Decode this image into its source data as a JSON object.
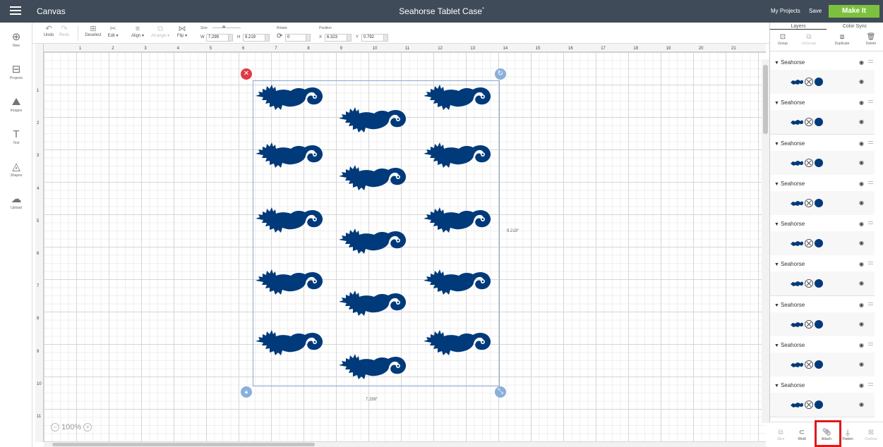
{
  "topbar": {
    "app_name": "Canvas",
    "doc_title": "Seahorse Tablet Case",
    "doc_modified": "*",
    "my_projects": "My Projects",
    "save": "Save",
    "make_it": "Make It"
  },
  "toolbar": {
    "undo": "Undo",
    "redo": "Redo",
    "deselect": "Deselect",
    "edit": "Edit ▾",
    "align": "Align ▾",
    "arrange": "Arrange ▾",
    "flip": "Flip ▾",
    "size_label": "Size",
    "w_label": "W",
    "w_value": "7.299",
    "h_label": "H",
    "h_value": "9.219",
    "rotate_label": "Rotate",
    "rotate_value": "0",
    "position_label": "Position",
    "x_label": "X",
    "x_value": "6.323",
    "y_label": "Y",
    "y_value": "0.792"
  },
  "leftpanel": {
    "new": "New",
    "projects": "Projects",
    "images": "Images",
    "text": "Text",
    "shapes": "Shapes",
    "upload": "Upload"
  },
  "ruler": {
    "top": [
      "1",
      "2",
      "3",
      "4",
      "5",
      "6",
      "7",
      "8",
      "9",
      "10",
      "11",
      "12",
      "13",
      "14",
      "15",
      "16",
      "17",
      "18",
      "19",
      "20",
      "21"
    ],
    "left": [
      "1",
      "2",
      "3",
      "4",
      "5",
      "6",
      "7",
      "8",
      "9",
      "10",
      "11"
    ]
  },
  "canvas": {
    "width_label": "7.299\"",
    "height_label": "9.219\"",
    "zoom": "100%",
    "design_color": "#003a7a"
  },
  "rightpanel": {
    "tab_layers": "Layers",
    "tab_color_sync": "Color Sync",
    "group": "Group",
    "ungroup": "UnGroup",
    "duplicate": "Duplicate",
    "delete": "Delete",
    "layers": [
      {
        "name": "Seahorse"
      },
      {
        "name": "Seahorse"
      },
      {
        "name": "Seahorse"
      },
      {
        "name": "Seahorse"
      },
      {
        "name": "Seahorse"
      },
      {
        "name": "Seahorse"
      },
      {
        "name": "Seahorse"
      },
      {
        "name": "Seahorse"
      },
      {
        "name": "Seahorse"
      }
    ],
    "bottom": {
      "slice": "Slice",
      "weld": "Weld",
      "attach": "Attach",
      "flatten": "Flatten",
      "contour": "Contour"
    }
  }
}
